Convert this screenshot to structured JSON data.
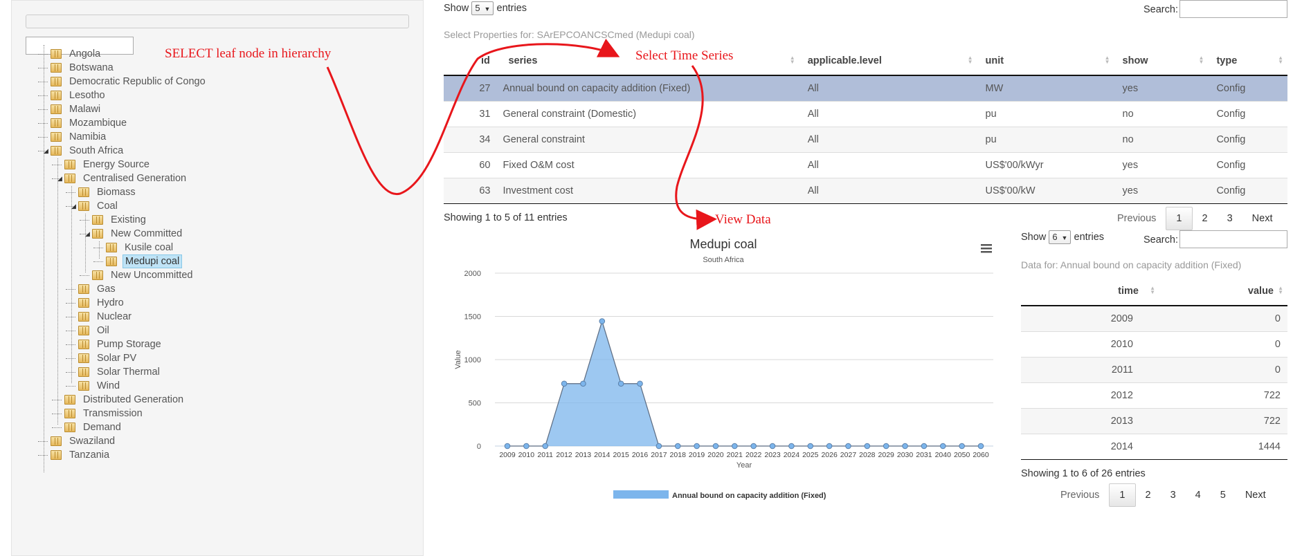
{
  "tree": {
    "items": [
      {
        "label": "Angola",
        "level": 0
      },
      {
        "label": "Botswana",
        "level": 0
      },
      {
        "label": "Democratic Republic of Congo",
        "level": 0
      },
      {
        "label": "Lesotho",
        "level": 0
      },
      {
        "label": "Malawi",
        "level": 0
      },
      {
        "label": "Mozambique",
        "level": 0
      },
      {
        "label": "Namibia",
        "level": 0
      },
      {
        "label": "South Africa",
        "level": 0,
        "expanded": true
      },
      {
        "label": "Energy Source",
        "level": 1
      },
      {
        "label": "Centralised Generation",
        "level": 1,
        "expanded": true
      },
      {
        "label": "Biomass",
        "level": 2
      },
      {
        "label": "Coal",
        "level": 2,
        "expanded": true
      },
      {
        "label": "Existing",
        "level": 3
      },
      {
        "label": "New Committed",
        "level": 3,
        "expanded": true
      },
      {
        "label": "Kusile coal",
        "level": 4
      },
      {
        "label": "Medupi coal",
        "level": 4,
        "selected": true
      },
      {
        "label": "New Uncommitted",
        "level": 3
      },
      {
        "label": "Gas",
        "level": 2
      },
      {
        "label": "Hydro",
        "level": 2
      },
      {
        "label": "Nuclear",
        "level": 2
      },
      {
        "label": "Oil",
        "level": 2
      },
      {
        "label": "Pump Storage",
        "level": 2
      },
      {
        "label": "Solar PV",
        "level": 2
      },
      {
        "label": "Solar Thermal",
        "level": 2
      },
      {
        "label": "Wind",
        "level": 2
      },
      {
        "label": "Distributed Generation",
        "level": 1
      },
      {
        "label": "Transmission",
        "level": 1
      },
      {
        "label": "Demand",
        "level": 1
      },
      {
        "label": "Swaziland",
        "level": 0
      },
      {
        "label": "Tanzania",
        "level": 0
      }
    ]
  },
  "annotations": {
    "select_leaf": "SELECT leaf node in hierarchy",
    "select_series": "Select Time Series",
    "view_data": "View Data",
    "color": "#e8161b"
  },
  "properties": {
    "show_label": "Show",
    "show_value": "5",
    "entries_label": "entries",
    "search_label": "Search:",
    "caption": "Select Properties for: SArEPCOANCSCmed (Medupi coal)",
    "columns": [
      "id",
      "series",
      "applicable.level",
      "unit",
      "show",
      "type"
    ],
    "rows": [
      {
        "id": "27",
        "series": "Annual bound on capacity addition (Fixed)",
        "level": "All",
        "unit": "MW",
        "show": "yes",
        "type": "Config",
        "selected": true
      },
      {
        "id": "31",
        "series": "General constraint (Domestic)",
        "level": "All",
        "unit": "pu",
        "show": "no",
        "type": "Config"
      },
      {
        "id": "34",
        "series": "General constraint",
        "level": "All",
        "unit": "pu",
        "show": "no",
        "type": "Config"
      },
      {
        "id": "60",
        "series": "Fixed O&M cost",
        "level": "All",
        "unit": "US$'00/kWyr",
        "show": "yes",
        "type": "Config"
      },
      {
        "id": "63",
        "series": "Investment cost",
        "level": "All",
        "unit": "US$'00/kW",
        "show": "yes",
        "type": "Config"
      }
    ],
    "info": "Showing 1 to 5 of 11 entries",
    "pager": {
      "previous": "Previous",
      "pages": [
        "1",
        "2",
        "3"
      ],
      "next": "Next",
      "current": "1"
    }
  },
  "chart_data": {
    "type": "area",
    "title": "Medupi coal",
    "subtitle": "South Africa",
    "xlabel": "Year",
    "ylabel": "Value",
    "ylim": [
      0,
      2000
    ],
    "yticks": [
      0,
      500,
      1000,
      1500,
      2000
    ],
    "grid": true,
    "legend_position": "bottom",
    "color": "#7cb5ec",
    "x": [
      "2009",
      "2010",
      "2011",
      "2012",
      "2013",
      "2014",
      "2015",
      "2016",
      "2017",
      "2018",
      "2019",
      "2020",
      "2021",
      "2022",
      "2023",
      "2024",
      "2025",
      "2026",
      "2027",
      "2028",
      "2029",
      "2030",
      "2031",
      "2040",
      "2050",
      "2060"
    ],
    "series": [
      {
        "name": "Annual bound on capacity addition (Fixed)",
        "values": [
          0,
          0,
          0,
          722,
          722,
          1444,
          722,
          722,
          0,
          0,
          0,
          0,
          0,
          0,
          0,
          0,
          0,
          0,
          0,
          0,
          0,
          0,
          0,
          0,
          0,
          0
        ]
      }
    ],
    "menu_icon": "hamburger-menu-icon"
  },
  "data_table": {
    "show_label": "Show",
    "show_value": "6",
    "entries_label": "entries",
    "search_label": "Search:",
    "caption": "Data for: Annual bound on capacity addition (Fixed)",
    "columns": [
      "time",
      "value"
    ],
    "rows": [
      {
        "time": "2009",
        "value": "0"
      },
      {
        "time": "2010",
        "value": "0"
      },
      {
        "time": "2011",
        "value": "0"
      },
      {
        "time": "2012",
        "value": "722"
      },
      {
        "time": "2013",
        "value": "722"
      },
      {
        "time": "2014",
        "value": "1444"
      }
    ],
    "info": "Showing 1 to 6 of 26 entries",
    "pager": {
      "previous": "Previous",
      "pages": [
        "1",
        "2",
        "3",
        "4",
        "5"
      ],
      "next": "Next",
      "current": "1"
    }
  }
}
